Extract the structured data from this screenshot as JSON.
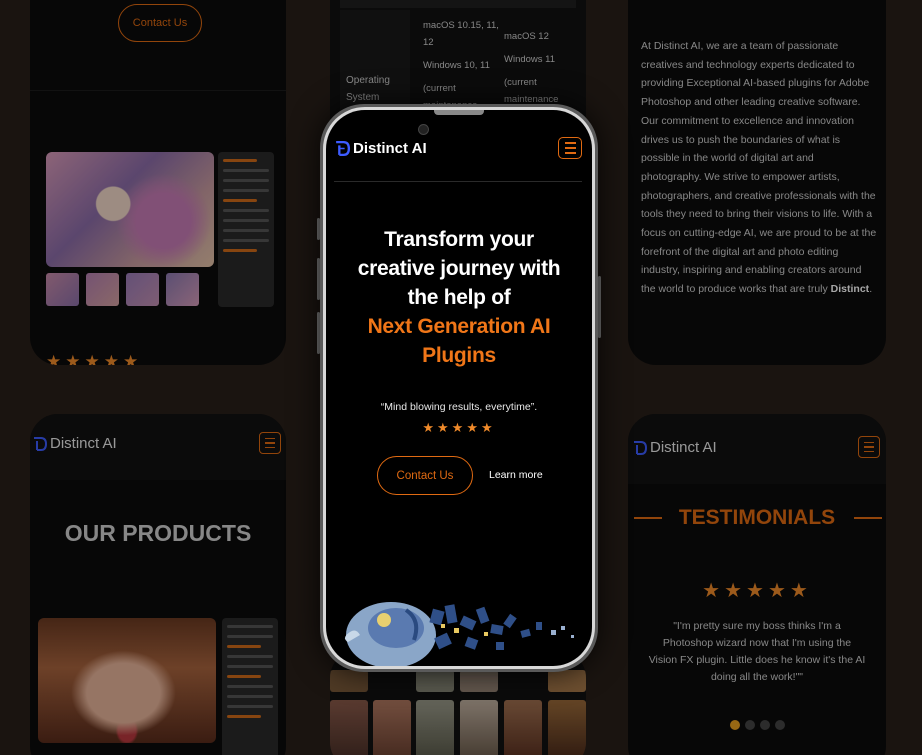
{
  "brand": {
    "name": "Distinct AI",
    "accent": "#e06a12",
    "logo_color": "#3d5cff"
  },
  "hero": {
    "headline_line1": "Transform your",
    "headline_line2": "creative journey with",
    "headline_line3": "the help of",
    "highlight_line1": "Next Generation AI",
    "highlight_line2": "Plugins",
    "quote": "“Mind blowing results, everytime”.",
    "stars": "★★★★★",
    "contact_label": "Contact Us",
    "learn_label": "Learn more"
  },
  "top_left": {
    "contact_label": "Contact Us",
    "stars": "★★★★★"
  },
  "requirements": {
    "label_line1": "Operating",
    "label_line2": "System",
    "mac_col": [
      "macOS 10.15, 11,",
      "12",
      "Windows 10, 11",
      "(current",
      "maintenance"
    ],
    "win_col": [
      "macOS 12",
      "Windows 11",
      "(current",
      "maintenance"
    ]
  },
  "about": {
    "text": "At Distinct AI, we are a team of passionate creatives and technology experts dedicated to providing Exceptional  AI-based plugins for Adobe Photoshop and other leading creative software. Our commitment to excellence and innovation drives us to push the boundaries of what is possible in the world of digital art and photography. We strive to empower artists, photographers, and creative professionals with the tools they need to bring their visions to life. With a focus on cutting-edge AI, we are proud to be at the forefront of the digital art and photo editing industry, inspiring and enabling creators around the world to produce works that are truly ",
    "emphasis": "Distinct",
    "end": "."
  },
  "products": {
    "title": "OUR PRODUCTS"
  },
  "testimonials": {
    "title": "TESTIMONIALS",
    "stars": "★★★★★",
    "quote": "\"I'm pretty sure my boss thinks I'm a Photoshop wizard now that I'm using the Vision FX plugin. Little does he know it's the AI doing all the work!\"\"",
    "active_dot": 1,
    "dot_count": 4
  }
}
